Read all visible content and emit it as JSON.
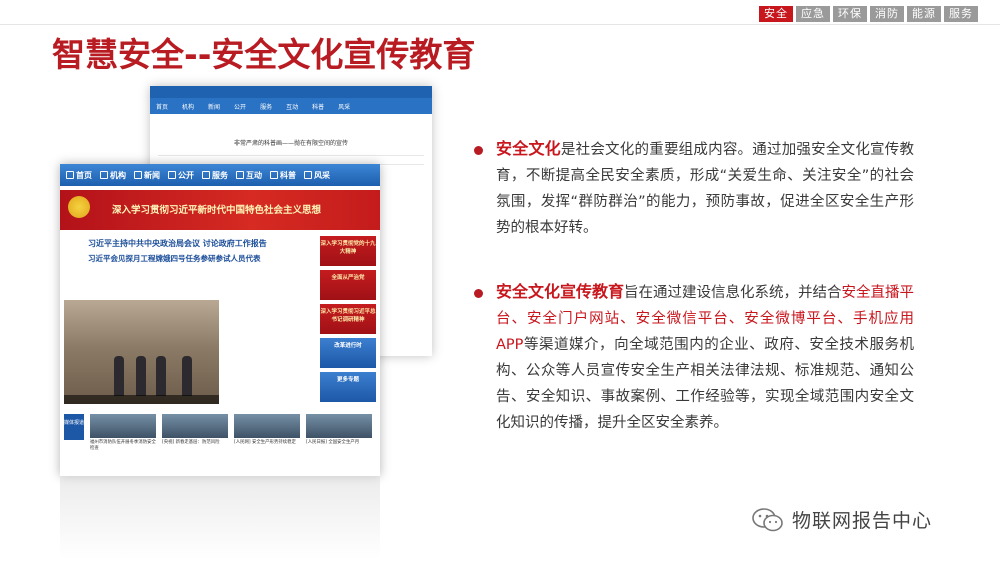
{
  "topnav": {
    "tabs": [
      {
        "label": "安全",
        "active": true
      },
      {
        "label": "应急",
        "active": false
      },
      {
        "label": "环保",
        "active": false
      },
      {
        "label": "消防",
        "active": false
      },
      {
        "label": "能源",
        "active": false
      },
      {
        "label": "服务",
        "active": false
      }
    ],
    "active_color": "#c8161d",
    "inactive_color": "#9a9a9a"
  },
  "title": "智慧安全--安全文化宣传教育",
  "screenshot_back": {
    "nav": [
      "首页",
      "机构",
      "新闻",
      "公开",
      "服务",
      "互动",
      "科普",
      "风采"
    ],
    "article_title": "非常严肃的科普画——抛在有限空间的宣传"
  },
  "screenshot_front": {
    "nav": [
      "首页",
      "机构",
      "新闻",
      "公开",
      "服务",
      "互动",
      "科普",
      "风采"
    ],
    "banner": "深入学习贯彻习近平新时代中国特色社会主义思想",
    "headline1": "习近平主持中共中央政治局会议 讨论政府工作报告",
    "headline2": "习近平会见探月工程嫦娥四号任务参研参试人员代表",
    "side_panels": [
      {
        "label": "深入学习贯彻党的十九大精神",
        "style": "red"
      },
      {
        "label": "全面从严治党",
        "style": "red"
      },
      {
        "label": "深入学习贯彻习近平总书记调研精神",
        "style": "red"
      },
      {
        "label": "改革进行时",
        "style": "blue"
      },
      {
        "label": "更多专题",
        "style": "blue"
      }
    ],
    "bottom_tag": "媒体报道",
    "bottom_thumbs": [
      "福州市消防队伍开展冬季消防安全检查",
      "[央视] 新春走基层：防范风险",
      "[人民网] 安全生产形势持续稳定",
      "[人民日报] 全国安全生产月"
    ]
  },
  "bullets": [
    {
      "key": "安全文化",
      "text": "是社会文化的重要组成内容。通过加强安全文化宣传教育，不断提高全民安全素质，形成“关爱生命、关注安全”的社会氛围，发挥“群防群治”的能力，预防事故，促进全区安全生产形势的根本好转。"
    },
    {
      "key": "安全文化宣传教育",
      "text_a": "旨在通过建设信息化系统，并结合",
      "red_text": "安全直播平台、安全门户网站、安全微信平台、安全微博平台、手机应用APP",
      "text_b": "等渠道媒介，向全域范围内的企业、政府、安全技术服务机构、公众等人员宣传安全生产相关法律法规、标准规范、通知公告、安全知识、事故案例、工作经验等，实现全域范围内安全文化知识的传播，提升全区安全素养。"
    }
  ],
  "watermark": {
    "icon": "wechat-icon",
    "text": "物联网报告中心"
  },
  "colors": {
    "brand_red": "#b81c22",
    "portal_blue": "#1d5fae"
  }
}
